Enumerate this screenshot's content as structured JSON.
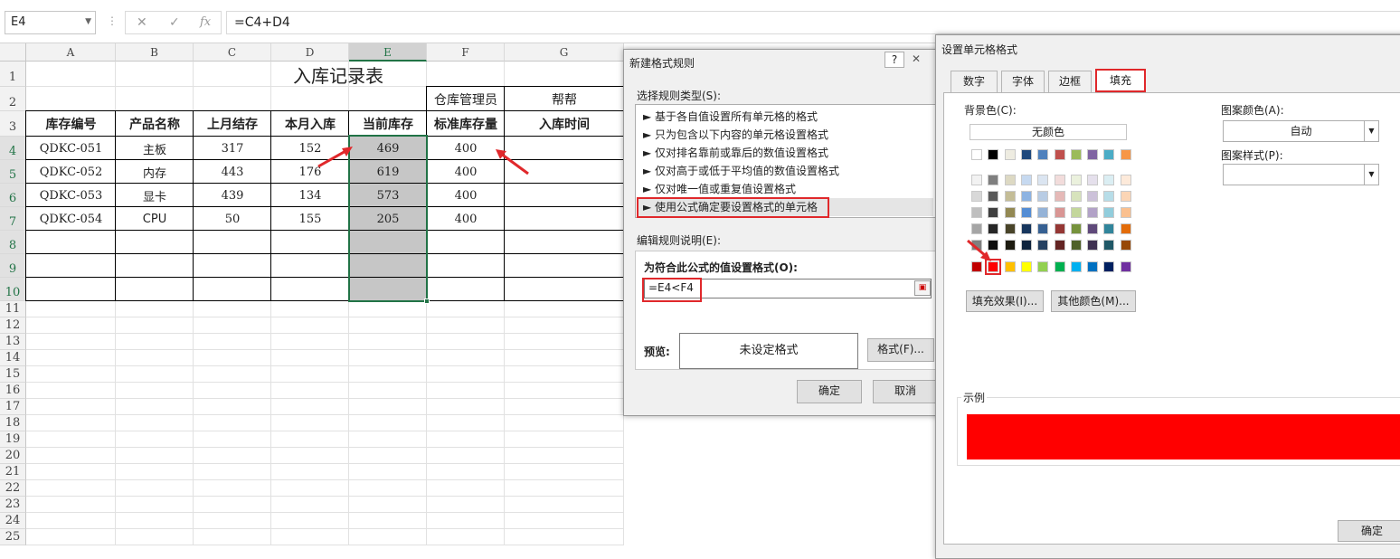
{
  "formula_bar": {
    "name_box": "E4",
    "sep_icon": "⋮",
    "cancel_icon": "✕",
    "enter_icon": "✓",
    "fx_icon": "fx",
    "formula": "=C4+D4"
  },
  "sheet": {
    "columns": [
      "A",
      "B",
      "C",
      "D",
      "E",
      "F",
      "G"
    ],
    "rows": [
      "1",
      "2",
      "3",
      "4",
      "5",
      "6",
      "7",
      "8",
      "9",
      "10",
      "11",
      "12",
      "13",
      "14",
      "15",
      "16",
      "17",
      "18",
      "19",
      "20",
      "21",
      "22",
      "23",
      "24",
      "25"
    ],
    "title": "入库记录表",
    "f2": "仓库管理员",
    "g2": "帮帮",
    "headers": [
      "库存编号",
      "产品名称",
      "上月结存",
      "本月入库",
      "当前库存",
      "标准库存量",
      "入库时间"
    ],
    "data": [
      [
        "QDKC-051",
        "主板",
        "317",
        "152",
        "469",
        "400",
        ""
      ],
      [
        "QDKC-052",
        "内存",
        "443",
        "176",
        "619",
        "400",
        ""
      ],
      [
        "QDKC-053",
        "显卡",
        "439",
        "134",
        "573",
        "400",
        ""
      ],
      [
        "QDKC-054",
        "CPU",
        "50",
        "155",
        "205",
        "400",
        ""
      ]
    ]
  },
  "rule_dialog": {
    "title": "新建格式规则",
    "help": "?",
    "close": "✕",
    "select_type_label": "选择规则类型(S):",
    "rule_types": [
      "► 基于各自值设置所有单元格的格式",
      "► 只为包含以下内容的单元格设置格式",
      "► 仅对排名靠前或靠后的数值设置格式",
      "► 仅对高于或低于平均值的数值设置格式",
      "► 仅对唯一值或重复值设置格式",
      "► 使用公式确定要设置格式的单元格"
    ],
    "edit_desc_label": "编辑规则说明(E):",
    "formula_label": "为符合此公式的值设置格式(O):",
    "formula_value": "=E4<F4",
    "preview_label": "预览:",
    "preview_text": "未设定格式",
    "format_button": "格式(F)...",
    "ok": "确定",
    "cancel": "取消"
  },
  "format_dialog": {
    "title": "设置单元格格式",
    "tabs": [
      "数字",
      "字体",
      "边框",
      "填充"
    ],
    "active_tab": "填充",
    "bg_color_label": "背景色(C):",
    "no_color": "无颜色",
    "pattern_color_label": "图案颜色(A):",
    "pattern_color_value": "自动",
    "pattern_style_label": "图案样式(P):",
    "fill_effects": "填充效果(I)...",
    "more_colors": "其他颜色(M)...",
    "sample_label": "示例",
    "sample_color": "#ff0000",
    "ok": "确定",
    "theme_row1": [
      "#ffffff",
      "#000000",
      "#eeece1",
      "#1f497d",
      "#4f81bd",
      "#c0504d",
      "#9bbb59",
      "#8064a2",
      "#4bacc6",
      "#f79646"
    ],
    "theme_rows": [
      [
        "#f2f2f2",
        "#7f7f7f",
        "#ddd9c3",
        "#c6d9f0",
        "#dbe5f1",
        "#f2dcdb",
        "#ebf1dd",
        "#e5e0ec",
        "#dbeef3",
        "#fdeada"
      ],
      [
        "#d8d8d8",
        "#595959",
        "#c4bd97",
        "#8db3e2",
        "#b8cce4",
        "#e5b9b7",
        "#d7e3bc",
        "#ccc1d9",
        "#b7dde8",
        "#fbd5b5"
      ],
      [
        "#bfbfbf",
        "#3f3f3f",
        "#938953",
        "#548dd4",
        "#95b3d7",
        "#d99694",
        "#c3d69b",
        "#b2a2c7",
        "#92cddc",
        "#fac08f"
      ],
      [
        "#a5a5a5",
        "#262626",
        "#494429",
        "#17365d",
        "#366092",
        "#953734",
        "#76923c",
        "#5f497a",
        "#31859b",
        "#e36c09"
      ],
      [
        "#7f7f7f",
        "#0c0c0c",
        "#1d1b10",
        "#0f243e",
        "#244061",
        "#632423",
        "#4f6128",
        "#3f3151",
        "#205867",
        "#974806"
      ]
    ],
    "standard_row": [
      "#c00000",
      "#ff0000",
      "#ffc000",
      "#ffff00",
      "#92d050",
      "#00b050",
      "#00b0f0",
      "#0070c0",
      "#002060",
      "#7030a0"
    ],
    "selected_color": "#ff0000"
  }
}
